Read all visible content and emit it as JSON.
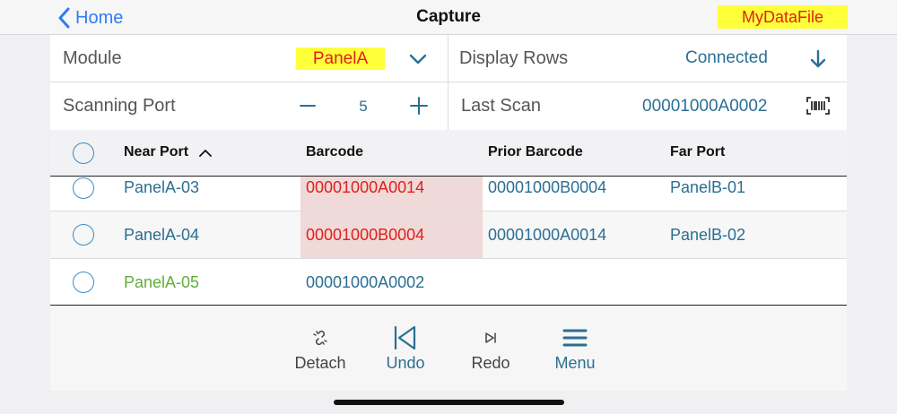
{
  "nav": {
    "back_label": "Home",
    "title": "Capture",
    "file_name": "MyDataFile"
  },
  "settings": {
    "module": {
      "label": "Module",
      "value": "PanelA"
    },
    "display_rows": {
      "label": "Display Rows",
      "value": "Connected"
    },
    "scanning_port": {
      "label": "Scanning Port",
      "value": "5"
    },
    "last_scan": {
      "label": "Last Scan",
      "value": "00001000A0002"
    }
  },
  "table": {
    "columns": [
      "Near Port",
      "Barcode",
      "Prior Barcode",
      "Far Port"
    ],
    "sort_column": "Near Port",
    "sort_direction": "ascending",
    "rows": [
      {
        "near_port": "PanelA-03",
        "barcode": "00001000A0014",
        "prior_barcode": "00001000B0004",
        "far_port": "PanelB-01"
      },
      {
        "near_port": "PanelA-04",
        "barcode": "00001000B0004",
        "prior_barcode": "00001000A0014",
        "far_port": "PanelB-02"
      },
      {
        "near_port": "PanelA-05",
        "barcode": "00001000A0002",
        "prior_barcode": "",
        "far_port": ""
      }
    ]
  },
  "toolbar": {
    "detach": "Detach",
    "undo": "Undo",
    "redo": "Redo",
    "menu": "Menu"
  },
  "colors": {
    "accent_blue": "#2f7cf6",
    "value_blue": "#2a6f93",
    "highlight_yellow": "#ffff3a",
    "error_red": "#e0201a",
    "new_green": "#62ad3a",
    "barcode_highlight": "#f0d9d9"
  },
  "icons": [
    "chevron-left-icon",
    "chevron-down-icon",
    "arrow-down-icon",
    "minus-icon",
    "plus-icon",
    "barcode-icon",
    "sort-up-icon",
    "detach-icon",
    "undo-icon",
    "redo-icon",
    "menu-icon"
  ]
}
